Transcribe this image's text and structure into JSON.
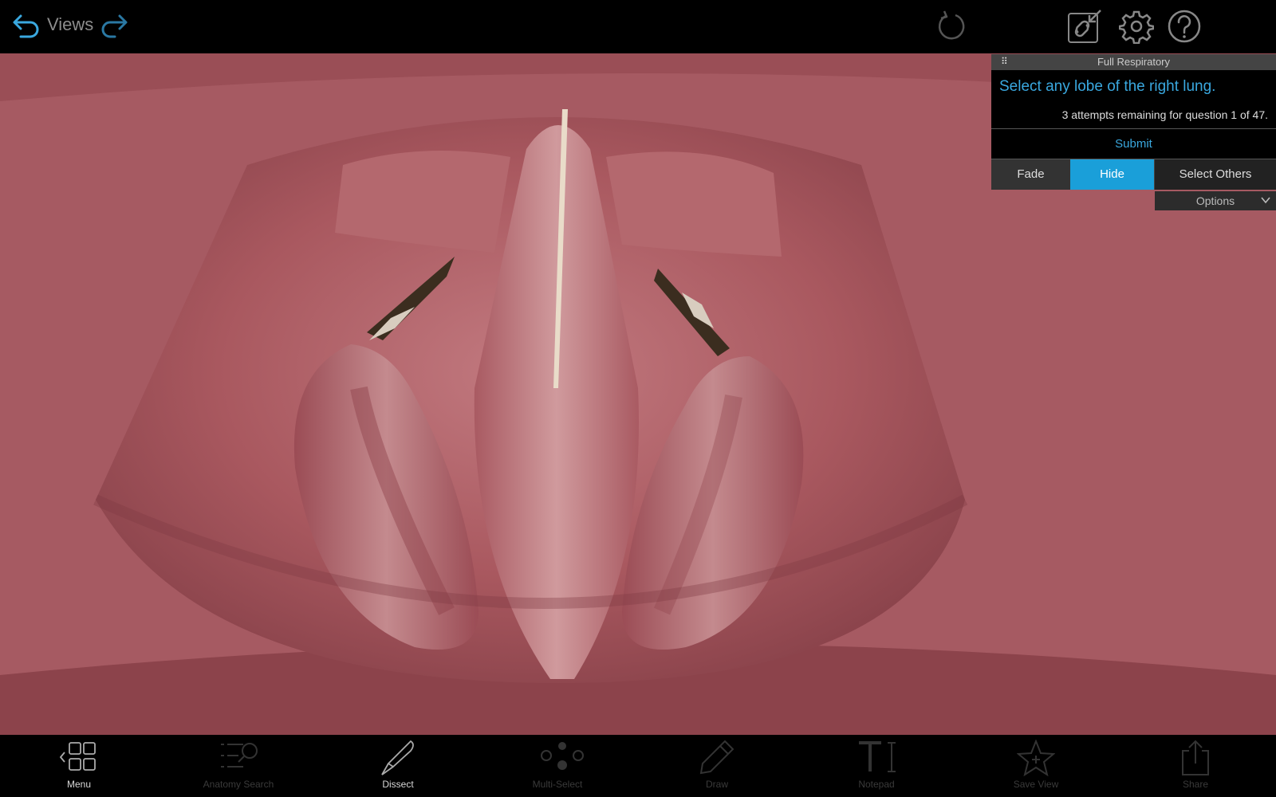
{
  "topbar": {
    "views_label": "Views",
    "icons": [
      "undo-arrow-icon",
      "redo-arrow-icon",
      "reset-view-icon",
      "link-icon",
      "gear-icon",
      "help-icon"
    ]
  },
  "quiz": {
    "header_title": "Full Respiratory",
    "grip_glyph": "⠿",
    "question": "Select any lobe of the right lung.",
    "attempts_text": "3 attempts remaining for question 1 of 47.",
    "submit_label": "Submit",
    "modes": {
      "fade": "Fade",
      "hide": "Hide",
      "select_others": "Select Others"
    },
    "selected_mode": "Hide",
    "options_label": "Options"
  },
  "toolbar": {
    "items": [
      {
        "label": "Menu",
        "icon": "grid-menu-icon",
        "active": true
      },
      {
        "label": "Anatomy Search",
        "icon": "search-list-icon",
        "active": false
      },
      {
        "label": "Dissect",
        "icon": "scalpel-icon",
        "active": true
      },
      {
        "label": "Multi-Select",
        "icon": "multi-select-icon",
        "active": false
      },
      {
        "label": "Draw",
        "icon": "pencil-icon",
        "active": false
      },
      {
        "label": "Notepad",
        "icon": "text-cursor-icon",
        "active": false
      },
      {
        "label": "Save View",
        "icon": "star-icon",
        "active": false
      },
      {
        "label": "Share",
        "icon": "share-icon",
        "active": false
      }
    ]
  },
  "colors": {
    "accent": "#1a9fd9",
    "link_blue": "#3aa8df",
    "tissue": "#a45860"
  }
}
